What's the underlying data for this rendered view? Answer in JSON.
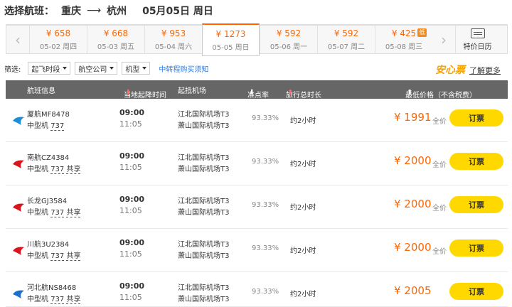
{
  "header": {
    "label": "选择航班：",
    "from": "重庆",
    "to": "杭州",
    "date": "05月05日 周日"
  },
  "dates": [
    {
      "price": "¥ 658",
      "date": "05-02 周四"
    },
    {
      "price": "¥ 668",
      "date": "05-03 周五"
    },
    {
      "price": "¥ 953",
      "date": "05-04 周六"
    },
    {
      "price": "¥ 1273",
      "date": "05-05 周日",
      "active": true
    },
    {
      "price": "¥ 592",
      "date": "05-06 周一"
    },
    {
      "price": "¥ 592",
      "date": "05-07 周二"
    },
    {
      "price": "¥ 425",
      "date": "05-08 周三",
      "badge": "低"
    }
  ],
  "calendar_label": "特价日历",
  "filters": {
    "label": "筛选:",
    "items": [
      "起飞时段",
      "航空公司",
      "机型"
    ],
    "link": "中转程购买须知",
    "anxin": "安心票",
    "learn_more": "了解更多"
  },
  "table_head": {
    "flight": "航班信息",
    "time": "当地起降时间",
    "airport": "起抵机场",
    "ontime": "准点率",
    "duration": "旅行总时长",
    "price": "最低价格（不含税费）"
  },
  "flights": [
    {
      "airline": "厦航MF8478",
      "plane_size": "中型机",
      "model": "737",
      "shared": "",
      "dep": "09:00",
      "arr": "11:05",
      "dep_airport": "江北国际机场T3",
      "arr_airport": "萧山国际机场T3",
      "ontime": "93.33%",
      "duration": "约2小时",
      "price": "¥ 1991",
      "fare_tag": "全价",
      "book": "订票",
      "logo_color": "#1a8fd8"
    },
    {
      "airline": "南航CZ4384",
      "plane_size": "中型机",
      "model": "737",
      "shared": "共享",
      "dep": "09:00",
      "arr": "11:05",
      "dep_airport": "江北国际机场T3",
      "arr_airport": "萧山国际机场T3",
      "ontime": "93.33%",
      "duration": "约2小时",
      "price": "¥ 2000",
      "fare_tag": "全价",
      "book": "订票",
      "logo_color": "#d8141d"
    },
    {
      "airline": "长龙GJ3584",
      "plane_size": "中型机",
      "model": "737",
      "shared": "共享",
      "dep": "09:00",
      "arr": "11:05",
      "dep_airport": "江北国际机场T3",
      "arr_airport": "萧山国际机场T3",
      "ontime": "93.33%",
      "duration": "约2小时",
      "price": "¥ 2000",
      "fare_tag": "全价",
      "book": "订票",
      "logo_color": "#d8141d"
    },
    {
      "airline": "川航3U2384",
      "plane_size": "中型机",
      "model": "737",
      "shared": "共享",
      "dep": "09:00",
      "arr": "11:05",
      "dep_airport": "江北国际机场T3",
      "arr_airport": "萧山国际机场T3",
      "ontime": "93.33%",
      "duration": "约2小时",
      "price": "¥ 2000",
      "fare_tag": "全价",
      "book": "订票",
      "logo_color": "#d8141d"
    },
    {
      "airline": "河北航NS8468",
      "plane_size": "中型机",
      "model": "737",
      "shared": "共享",
      "dep": "09:00",
      "arr": "11:05",
      "dep_airport": "江北国际机场T3",
      "arr_airport": "萧山国际机场T3",
      "ontime": "93.33%",
      "duration": "约2小时",
      "price": "¥ 2005",
      "fare_tag": "",
      "book": "订票",
      "logo_color": "#1a6fd0"
    }
  ]
}
